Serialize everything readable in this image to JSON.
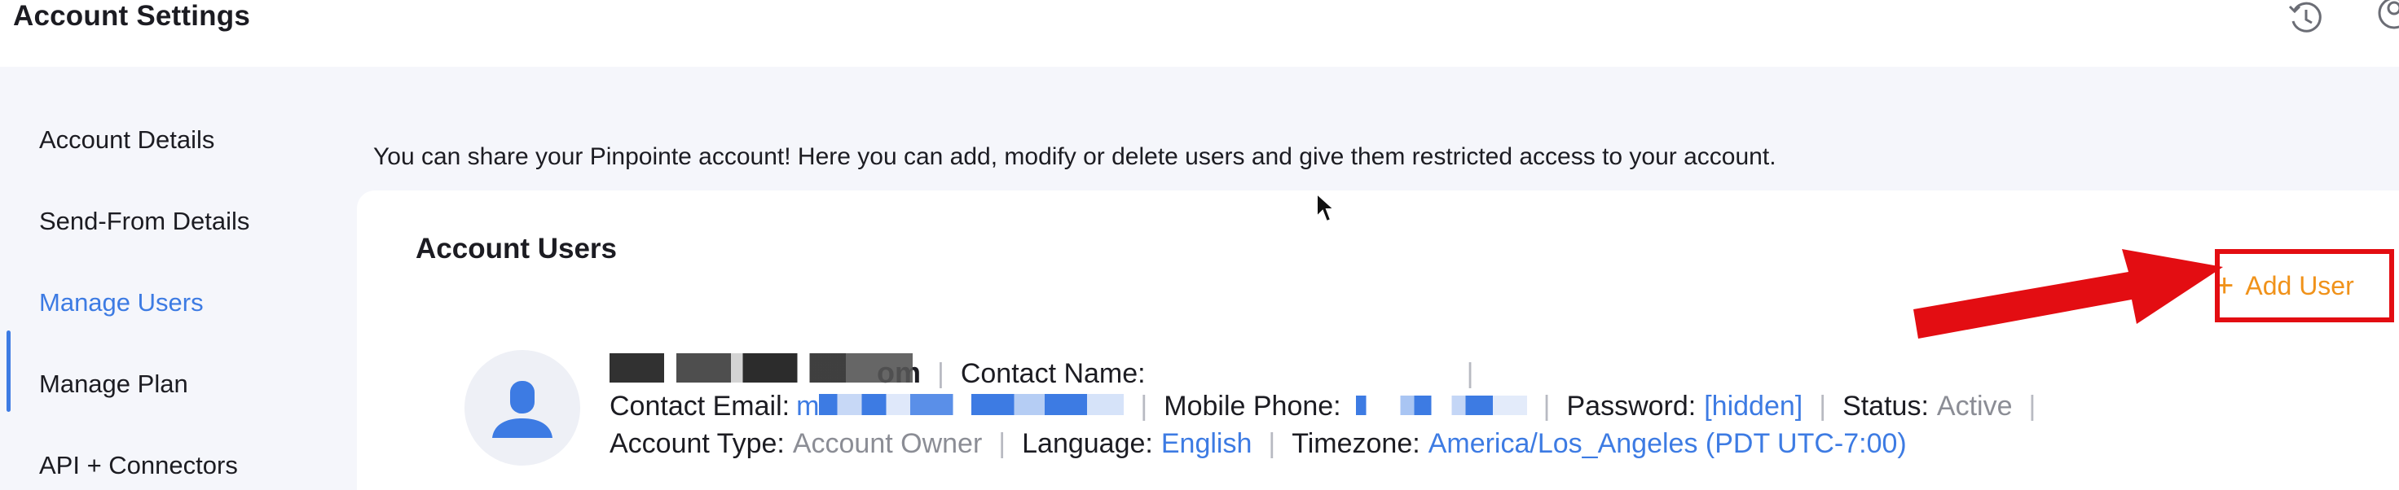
{
  "header": {
    "title": "Account Settings",
    "history_icon": "history-icon",
    "profile_icon": "profile-icon"
  },
  "sidebar": {
    "items": [
      {
        "label": "Account Details"
      },
      {
        "label": "Send-From Details"
      },
      {
        "label": "Manage Users",
        "active": true
      },
      {
        "label": "Manage Plan"
      },
      {
        "label": "API + Connectors"
      }
    ]
  },
  "main": {
    "intro": "You can share your Pinpointe account! Here you can add, modify or delete users and give them restricted access to your account.",
    "card_title": "Account Users",
    "add_user": {
      "icon": "+",
      "label": "Add User"
    },
    "user": {
      "email_suffix": "om",
      "contact_name_label": "Contact Name:",
      "contact_email_label": "Contact Email:",
      "contact_email_prefix": "m",
      "mobile_phone_label": "Mobile Phone:",
      "password_label": "Password:",
      "password_value": "[hidden]",
      "status_label": "Status:",
      "status_value": "Active",
      "account_type_label": "Account Type:",
      "account_type_value": "Account Owner",
      "language_label": "Language:",
      "language_value": "English",
      "timezone_label": "Timezone:",
      "timezone_value": "America/Los_Angeles (PDT UTC-7:00)",
      "separator": "|"
    }
  },
  "colors": {
    "accent": "#3d7be3",
    "add_user": "#f0921a",
    "highlight": "#e30d12",
    "muted": "#8b8d95"
  }
}
